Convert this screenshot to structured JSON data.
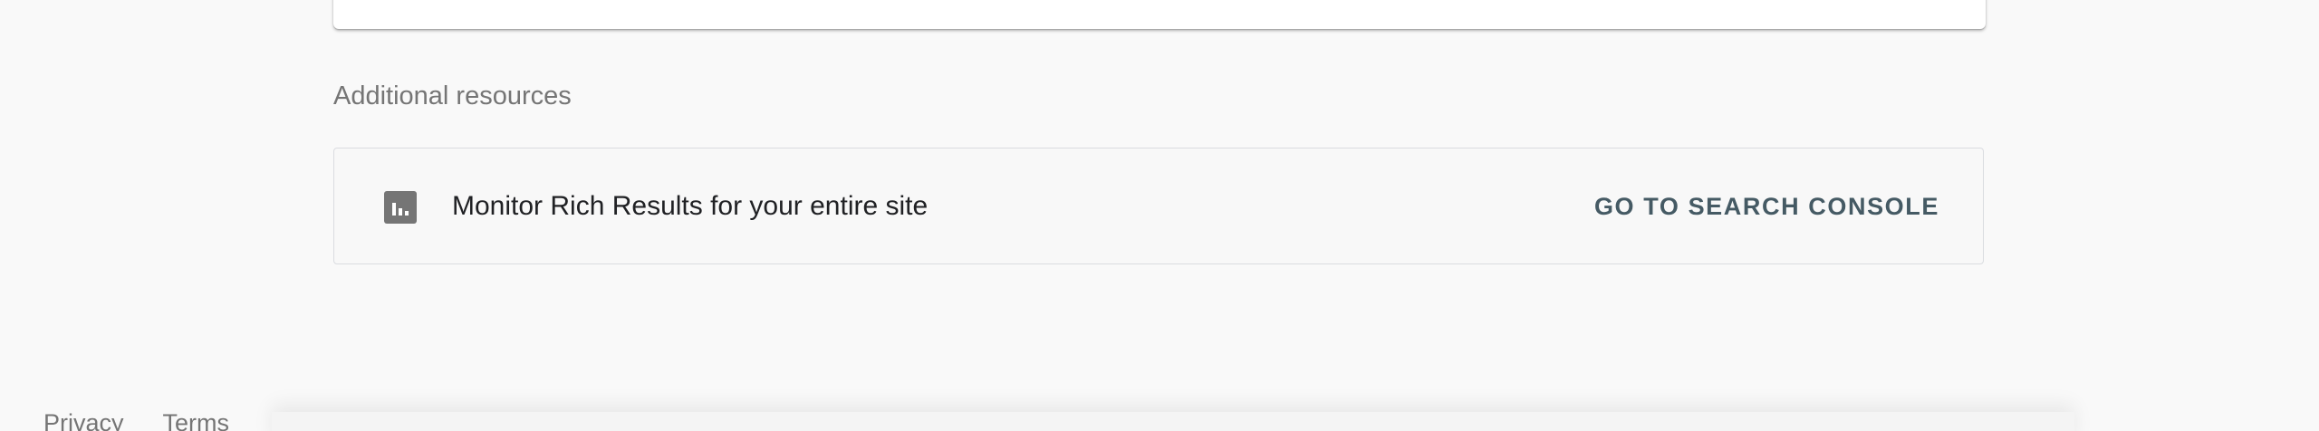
{
  "additional_resources": {
    "heading": "Additional resources",
    "card": {
      "icon": "bar-chart-icon",
      "text": "Monitor Rich Results for your entire site",
      "button_label": "GO TO SEARCH CONSOLE"
    }
  },
  "footer": {
    "links": [
      "Privacy",
      "Terms"
    ]
  }
}
